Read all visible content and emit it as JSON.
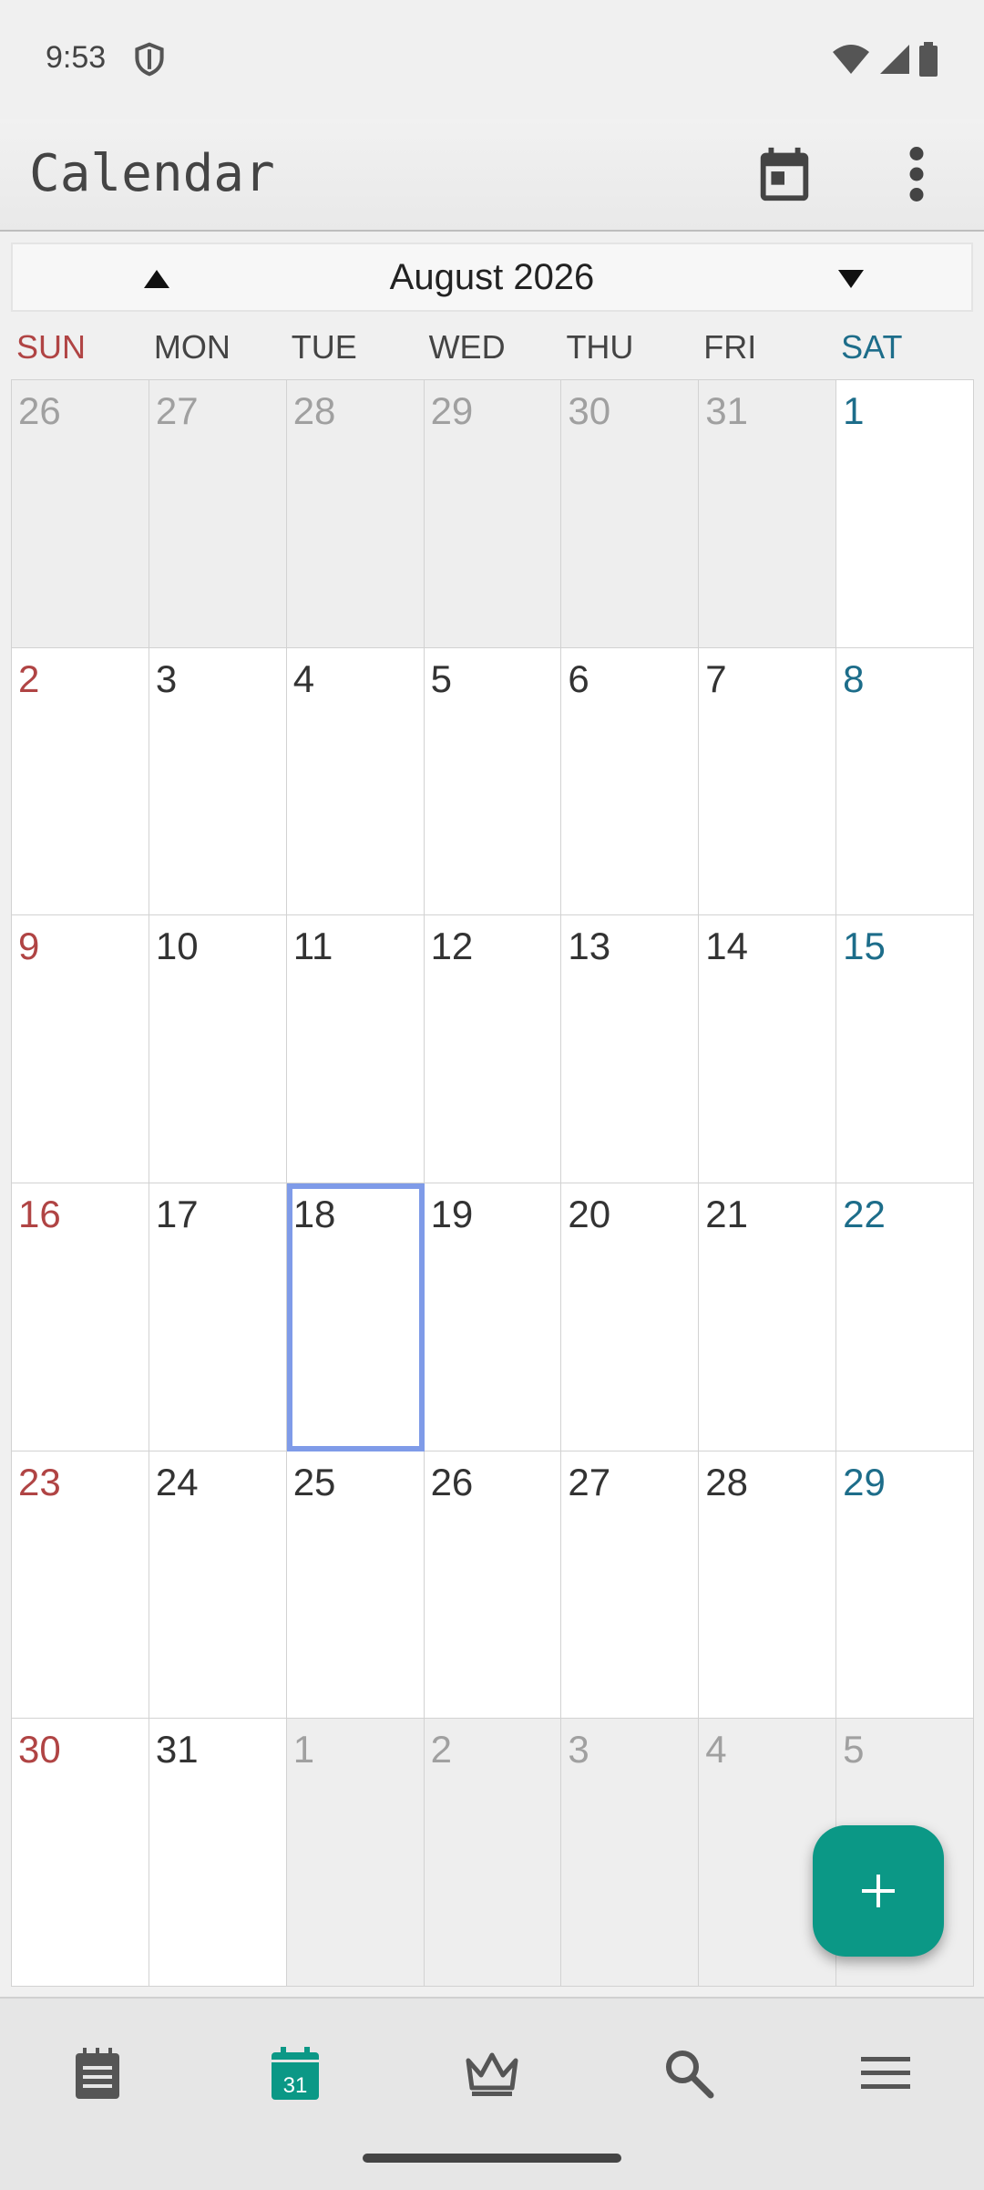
{
  "status_bar": {
    "time": "9:53"
  },
  "app_bar": {
    "title": "Calendar"
  },
  "month_nav": {
    "label": "August 2026"
  },
  "weekdays": [
    "SUN",
    "MON",
    "TUE",
    "WED",
    "THU",
    "FRI",
    "SAT"
  ],
  "calendar": {
    "weeks": [
      [
        {
          "d": "26",
          "other": true
        },
        {
          "d": "27",
          "other": true
        },
        {
          "d": "28",
          "other": true
        },
        {
          "d": "29",
          "other": true
        },
        {
          "d": "30",
          "other": true
        },
        {
          "d": "31",
          "other": true
        },
        {
          "d": "1"
        }
      ],
      [
        {
          "d": "2"
        },
        {
          "d": "3"
        },
        {
          "d": "4"
        },
        {
          "d": "5"
        },
        {
          "d": "6"
        },
        {
          "d": "7"
        },
        {
          "d": "8"
        }
      ],
      [
        {
          "d": "9"
        },
        {
          "d": "10"
        },
        {
          "d": "11"
        },
        {
          "d": "12"
        },
        {
          "d": "13"
        },
        {
          "d": "14"
        },
        {
          "d": "15"
        }
      ],
      [
        {
          "d": "16"
        },
        {
          "d": "17"
        },
        {
          "d": "18",
          "selected": true
        },
        {
          "d": "19"
        },
        {
          "d": "20"
        },
        {
          "d": "21"
        },
        {
          "d": "22"
        }
      ],
      [
        {
          "d": "23"
        },
        {
          "d": "24"
        },
        {
          "d": "25"
        },
        {
          "d": "26"
        },
        {
          "d": "27"
        },
        {
          "d": "28"
        },
        {
          "d": "29"
        }
      ],
      [
        {
          "d": "30"
        },
        {
          "d": "31"
        },
        {
          "d": "1",
          "other": true
        },
        {
          "d": "2",
          "other": true
        },
        {
          "d": "3",
          "other": true
        },
        {
          "d": "4",
          "other": true
        },
        {
          "d": "5",
          "other": true
        }
      ]
    ]
  },
  "bottom_nav": {
    "items": [
      {
        "icon": "notepad-icon",
        "active": false
      },
      {
        "icon": "calendar-icon",
        "label": "31",
        "active": true
      },
      {
        "icon": "crown-icon",
        "active": false
      },
      {
        "icon": "search-icon",
        "active": false
      },
      {
        "icon": "menu-icon",
        "active": false
      }
    ]
  },
  "colors": {
    "accent": "#0b9886",
    "sunday": "#b04444",
    "saturday": "#1d6d8a",
    "selection": "#7f9be8"
  }
}
